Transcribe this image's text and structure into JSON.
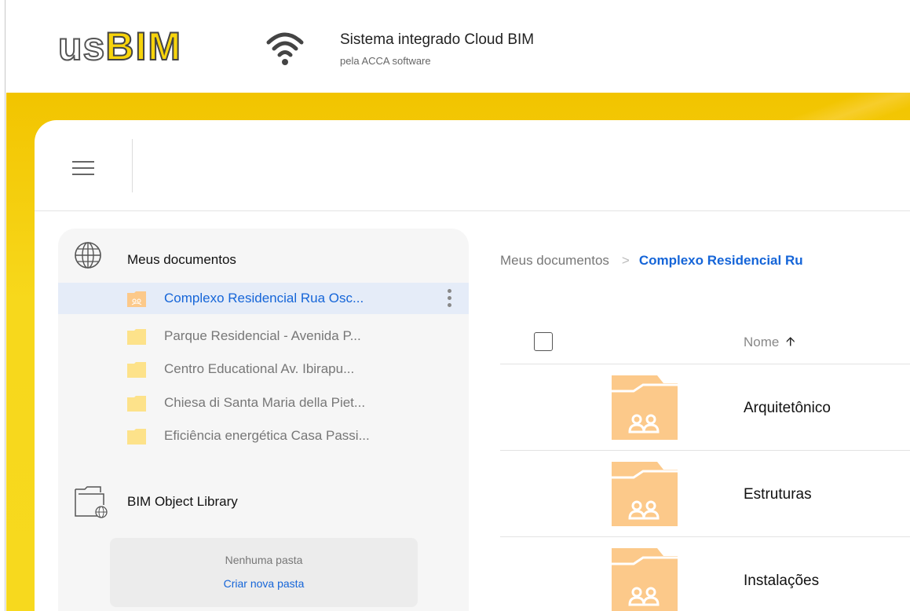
{
  "header": {
    "logo_us": "us",
    "logo_bim": "BIM",
    "title": "Sistema integrado Cloud BIM",
    "subtitle": "pela ACCA software"
  },
  "sidebar": {
    "my_documents": "Meus documentos",
    "folders": [
      {
        "label": "Complexo Residencial Rua Osc...",
        "active": true
      },
      {
        "label": "Parque Residencial - Avenida P...",
        "active": false
      },
      {
        "label": "Centro Educational Av. Ibirapu...",
        "active": false
      },
      {
        "label": "Chiesa di Santa Maria della Piet...",
        "active": false
      },
      {
        "label": "Eficiência energética Casa Passi...",
        "active": false
      }
    ],
    "library_title": "BIM Object Library",
    "empty_text": "Nenhuma pasta",
    "create_link": "Criar nova pasta"
  },
  "breadcrumb": {
    "root": "Meus documentos",
    "separator": ">",
    "current": "Complexo Residencial Ru"
  },
  "table": {
    "name_header": "Nome",
    "sort_icon": "arrow-up-icon",
    "rows": [
      "Arquitetônico",
      "Estruturas",
      "Instalações"
    ]
  },
  "colors": {
    "accent_yellow": "#F7D81C",
    "link_blue": "#1565D8",
    "folder_shared": "#FCCB8A",
    "folder_plain": "#FDE28A",
    "active_row": "#E5ECF8"
  }
}
